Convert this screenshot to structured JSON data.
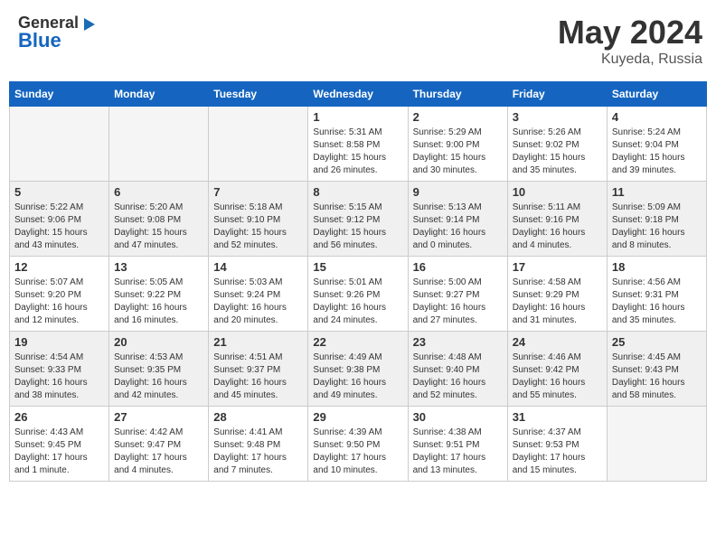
{
  "header": {
    "logo_general": "General",
    "logo_blue": "Blue",
    "title": "May 2024",
    "location": "Kuyeda, Russia"
  },
  "calendar": {
    "days_of_week": [
      "Sunday",
      "Monday",
      "Tuesday",
      "Wednesday",
      "Thursday",
      "Friday",
      "Saturday"
    ],
    "weeks": [
      {
        "shaded": false,
        "days": [
          {
            "number": "",
            "info": "",
            "empty": true
          },
          {
            "number": "",
            "info": "",
            "empty": true
          },
          {
            "number": "",
            "info": "",
            "empty": true
          },
          {
            "number": "1",
            "info": "Sunrise: 5:31 AM\nSunset: 8:58 PM\nDaylight: 15 hours\nand 26 minutes.",
            "empty": false
          },
          {
            "number": "2",
            "info": "Sunrise: 5:29 AM\nSunset: 9:00 PM\nDaylight: 15 hours\nand 30 minutes.",
            "empty": false
          },
          {
            "number": "3",
            "info": "Sunrise: 5:26 AM\nSunset: 9:02 PM\nDaylight: 15 hours\nand 35 minutes.",
            "empty": false
          },
          {
            "number": "4",
            "info": "Sunrise: 5:24 AM\nSunset: 9:04 PM\nDaylight: 15 hours\nand 39 minutes.",
            "empty": false
          }
        ]
      },
      {
        "shaded": true,
        "days": [
          {
            "number": "5",
            "info": "Sunrise: 5:22 AM\nSunset: 9:06 PM\nDaylight: 15 hours\nand 43 minutes.",
            "empty": false
          },
          {
            "number": "6",
            "info": "Sunrise: 5:20 AM\nSunset: 9:08 PM\nDaylight: 15 hours\nand 47 minutes.",
            "empty": false
          },
          {
            "number": "7",
            "info": "Sunrise: 5:18 AM\nSunset: 9:10 PM\nDaylight: 15 hours\nand 52 minutes.",
            "empty": false
          },
          {
            "number": "8",
            "info": "Sunrise: 5:15 AM\nSunset: 9:12 PM\nDaylight: 15 hours\nand 56 minutes.",
            "empty": false
          },
          {
            "number": "9",
            "info": "Sunrise: 5:13 AM\nSunset: 9:14 PM\nDaylight: 16 hours\nand 0 minutes.",
            "empty": false
          },
          {
            "number": "10",
            "info": "Sunrise: 5:11 AM\nSunset: 9:16 PM\nDaylight: 16 hours\nand 4 minutes.",
            "empty": false
          },
          {
            "number": "11",
            "info": "Sunrise: 5:09 AM\nSunset: 9:18 PM\nDaylight: 16 hours\nand 8 minutes.",
            "empty": false
          }
        ]
      },
      {
        "shaded": false,
        "days": [
          {
            "number": "12",
            "info": "Sunrise: 5:07 AM\nSunset: 9:20 PM\nDaylight: 16 hours\nand 12 minutes.",
            "empty": false
          },
          {
            "number": "13",
            "info": "Sunrise: 5:05 AM\nSunset: 9:22 PM\nDaylight: 16 hours\nand 16 minutes.",
            "empty": false
          },
          {
            "number": "14",
            "info": "Sunrise: 5:03 AM\nSunset: 9:24 PM\nDaylight: 16 hours\nand 20 minutes.",
            "empty": false
          },
          {
            "number": "15",
            "info": "Sunrise: 5:01 AM\nSunset: 9:26 PM\nDaylight: 16 hours\nand 24 minutes.",
            "empty": false
          },
          {
            "number": "16",
            "info": "Sunrise: 5:00 AM\nSunset: 9:27 PM\nDaylight: 16 hours\nand 27 minutes.",
            "empty": false
          },
          {
            "number": "17",
            "info": "Sunrise: 4:58 AM\nSunset: 9:29 PM\nDaylight: 16 hours\nand 31 minutes.",
            "empty": false
          },
          {
            "number": "18",
            "info": "Sunrise: 4:56 AM\nSunset: 9:31 PM\nDaylight: 16 hours\nand 35 minutes.",
            "empty": false
          }
        ]
      },
      {
        "shaded": true,
        "days": [
          {
            "number": "19",
            "info": "Sunrise: 4:54 AM\nSunset: 9:33 PM\nDaylight: 16 hours\nand 38 minutes.",
            "empty": false
          },
          {
            "number": "20",
            "info": "Sunrise: 4:53 AM\nSunset: 9:35 PM\nDaylight: 16 hours\nand 42 minutes.",
            "empty": false
          },
          {
            "number": "21",
            "info": "Sunrise: 4:51 AM\nSunset: 9:37 PM\nDaylight: 16 hours\nand 45 minutes.",
            "empty": false
          },
          {
            "number": "22",
            "info": "Sunrise: 4:49 AM\nSunset: 9:38 PM\nDaylight: 16 hours\nand 49 minutes.",
            "empty": false
          },
          {
            "number": "23",
            "info": "Sunrise: 4:48 AM\nSunset: 9:40 PM\nDaylight: 16 hours\nand 52 minutes.",
            "empty": false
          },
          {
            "number": "24",
            "info": "Sunrise: 4:46 AM\nSunset: 9:42 PM\nDaylight: 16 hours\nand 55 minutes.",
            "empty": false
          },
          {
            "number": "25",
            "info": "Sunrise: 4:45 AM\nSunset: 9:43 PM\nDaylight: 16 hours\nand 58 minutes.",
            "empty": false
          }
        ]
      },
      {
        "shaded": false,
        "days": [
          {
            "number": "26",
            "info": "Sunrise: 4:43 AM\nSunset: 9:45 PM\nDaylight: 17 hours\nand 1 minute.",
            "empty": false
          },
          {
            "number": "27",
            "info": "Sunrise: 4:42 AM\nSunset: 9:47 PM\nDaylight: 17 hours\nand 4 minutes.",
            "empty": false
          },
          {
            "number": "28",
            "info": "Sunrise: 4:41 AM\nSunset: 9:48 PM\nDaylight: 17 hours\nand 7 minutes.",
            "empty": false
          },
          {
            "number": "29",
            "info": "Sunrise: 4:39 AM\nSunset: 9:50 PM\nDaylight: 17 hours\nand 10 minutes.",
            "empty": false
          },
          {
            "number": "30",
            "info": "Sunrise: 4:38 AM\nSunset: 9:51 PM\nDaylight: 17 hours\nand 13 minutes.",
            "empty": false
          },
          {
            "number": "31",
            "info": "Sunrise: 4:37 AM\nSunset: 9:53 PM\nDaylight: 17 hours\nand 15 minutes.",
            "empty": false
          },
          {
            "number": "",
            "info": "",
            "empty": true
          }
        ]
      }
    ]
  }
}
